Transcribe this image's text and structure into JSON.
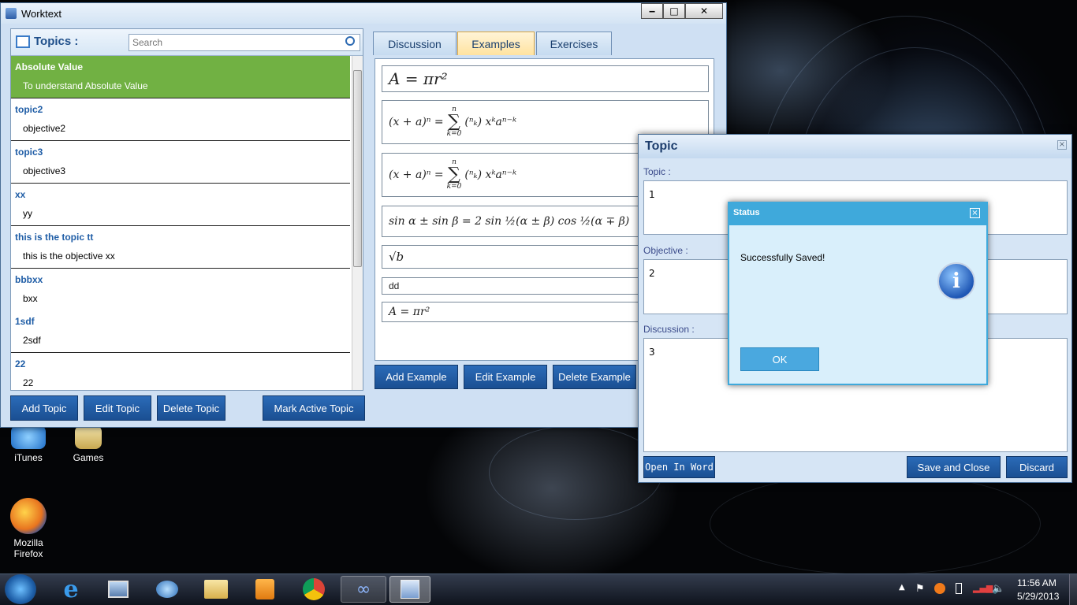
{
  "desktop": {
    "icons": [
      {
        "label": "iTunes",
        "color": "#3fa0e8"
      },
      {
        "label": "Games",
        "color": "#e0c870"
      },
      {
        "label": "Mozilla Firefox",
        "color": "#e8741f"
      }
    ]
  },
  "worktext": {
    "title": "Worktext",
    "controls": {
      "minimize": "‒",
      "maximize": "□",
      "close": "✕"
    },
    "topics_header": "Topics :",
    "search_placeholder": "Search",
    "topics": [
      {
        "topic": "Absolute Value",
        "objective": "To understand Absolute Value"
      },
      {
        "topic": "topic2",
        "objective": "objective2"
      },
      {
        "topic": "topic3",
        "objective": "objective3"
      },
      {
        "topic": "xx",
        "objective": "yy"
      },
      {
        "topic": "this is the topic tt",
        "objective": "this is the objective xx"
      },
      {
        "topic": "bbbxx",
        "objective": "bxx"
      },
      {
        "topic": "1sdf",
        "objective": "2sdf"
      },
      {
        "topic": "22",
        "objective": "22"
      }
    ],
    "tabs": [
      "Discussion",
      "Examples",
      "Exercises"
    ],
    "selected_tab": "Examples",
    "examples": {
      "e1": "A = πr²",
      "e2_lhs": "(x + a)ⁿ =",
      "e2_sum_top": "n",
      "e2_sum_bottom": "k=0",
      "e2_sum": "∑",
      "e2_binom": "(ⁿₖ) xᵏaⁿ⁻ᵏ",
      "e4": "sin α ± sin β = 2 sin ½(α ± β) cos ½(α ∓ β)",
      "e5": "√b",
      "e6": "dd",
      "e7": "A = πr²"
    },
    "buttons": {
      "add_example": "Add Example",
      "edit_example": "Edit Example",
      "delete_example": "Delete Example",
      "add_topic": "Add Topic",
      "edit_topic": "Edit Topic",
      "delete_topic": "Delete Topic",
      "mark_active": "Mark Active Topic"
    }
  },
  "topic_dialog": {
    "title": "Topic",
    "topic_label": "Topic :",
    "topic_value": "1",
    "objective_label": "Objective :",
    "objective_value": "2",
    "discussion_label": "Discussion :",
    "discussion_value": "3",
    "buttons": {
      "open_in_word": "Open In Word",
      "save_and_close": "Save and Close",
      "discard": "Discard"
    }
  },
  "status_dialog": {
    "title": "Status",
    "message": "Successfully Saved!",
    "ok": "OK",
    "info_glyph": "i"
  },
  "taskbar": {
    "time": "11:56 AM",
    "date": "5/29/2013",
    "icons": [
      "start-orb",
      "internet-explorer-icon",
      "computer-icon",
      "network-icon",
      "folder-icon",
      "media-player-icon",
      "chrome-icon",
      "infinity-app-icon",
      "worktext-app-icon"
    ]
  },
  "colors": {
    "accent": "#1f5da6",
    "active_topic": "#71b143",
    "status_header": "#3fa9db",
    "ok_button": "#4aa8df"
  }
}
